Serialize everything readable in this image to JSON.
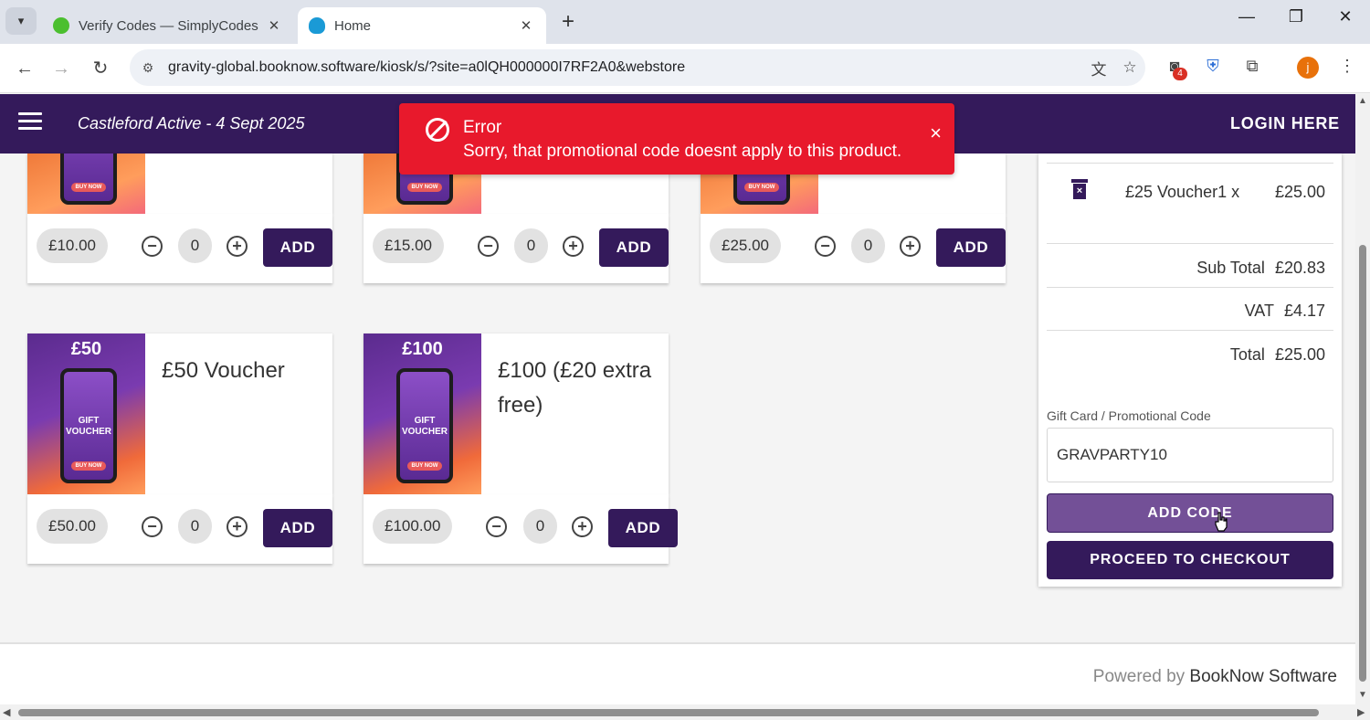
{
  "browser": {
    "tabs": [
      {
        "title": "Verify Codes — SimplyCodes",
        "favicon_color": "#4bbf2f"
      },
      {
        "title": "Home",
        "favicon_color": "#1a9ad6"
      }
    ],
    "url": "gravity-global.booknow.software/kiosk/s/?site=a0lQH000000I7RF2A0&webstore",
    "extensions_badge": "4",
    "profile_initial": "j"
  },
  "header": {
    "menu_icon": "hamburger-icon",
    "title": "Castleford Active - 4 Sept 2025",
    "login": "LOGIN HERE"
  },
  "toast": {
    "title": "Error",
    "message": "Sorry, that promotional code doesnt apply to this product.",
    "close": "×"
  },
  "products": [
    {
      "price": "£10.00",
      "qty": "0",
      "add": "ADD"
    },
    {
      "price": "£15.00",
      "qty": "0",
      "add": "ADD"
    },
    {
      "price": "£25.00",
      "qty": "0",
      "add": "ADD"
    },
    {
      "name": "£50 Voucher",
      "badge": "£50",
      "price": "£50.00",
      "qty": "0",
      "add": "ADD",
      "thumb_text": "GIFT VOUCHER",
      "thumb_button": "BUY NOW"
    },
    {
      "name": "£100 (£20 extra free)",
      "badge": "£100",
      "price": "£100.00",
      "qty": "0",
      "add": "ADD",
      "thumb_text": "GIFT VOUCHER",
      "thumb_button": "BUY NOW"
    }
  ],
  "cart": {
    "item_name": "£25 Voucher1 x",
    "item_price": "£25.00",
    "subtotal_label": "Sub Total",
    "subtotal": "£20.83",
    "vat_label": "VAT",
    "vat": "£4.17",
    "total_label": "Total",
    "total": "£25.00",
    "promo_label": "Gift Card / Promotional Code",
    "promo_value": "GRAVPARTY10",
    "add_code": "ADD CODE",
    "checkout": "PROCEED TO CHECKOUT"
  },
  "footer": {
    "powered_prefix": "Powered by",
    "brand": "BookNow Software"
  },
  "colors": {
    "brand_purple": "#341a5b",
    "error_red": "#e8192c",
    "add_code_purple": "#735097"
  }
}
